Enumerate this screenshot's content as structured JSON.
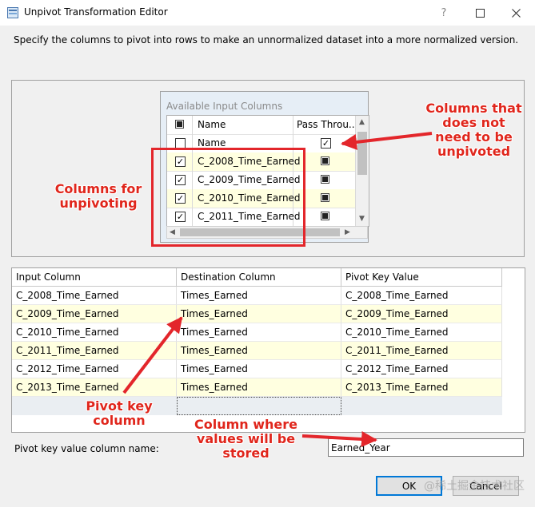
{
  "window": {
    "title": "Unpivot Transformation Editor",
    "help": "?",
    "maximize": "☐",
    "close": "✕"
  },
  "description": "Specify the columns to pivot into rows to make an unnormalized dataset into a more normalized version.",
  "available": {
    "title": "Available Input Columns",
    "headers": {
      "name": "Name",
      "pass": "Pass Throu..."
    },
    "rows": [
      {
        "name": "Name",
        "selected": false,
        "pass": true
      },
      {
        "name": "C_2008_Time_Earned",
        "selected": true,
        "pass": false
      },
      {
        "name": "C_2009_Time_Earned",
        "selected": true,
        "pass": false
      },
      {
        "name": "C_2010_Time_Earned",
        "selected": true,
        "pass": false
      },
      {
        "name": "C_2011_Time_Earned",
        "selected": true,
        "pass": false
      }
    ]
  },
  "mapping": {
    "headers": [
      "Input Column",
      "Destination Column",
      "Pivot Key Value"
    ],
    "rows": [
      [
        "C_2008_Time_Earned",
        "Times_Earned",
        "C_2008_Time_Earned"
      ],
      [
        "C_2009_Time_Earned",
        "Times_Earned",
        "C_2009_Time_Earned"
      ],
      [
        "C_2010_Time_Earned",
        "Times_Earned",
        "C_2010_Time_Earned"
      ],
      [
        "C_2011_Time_Earned",
        "Times_Earned",
        "C_2011_Time_Earned"
      ],
      [
        "C_2012_Time_Earned",
        "Times_Earned",
        "C_2012_Time_Earned"
      ],
      [
        "C_2013_Time_Earned",
        "Times_Earned",
        "C_2013_Time_Earned"
      ]
    ]
  },
  "pivot_key": {
    "label": "Pivot key value column name:",
    "value": "Earned_Year"
  },
  "buttons": {
    "ok": "OK",
    "cancel": "Cancel"
  },
  "annotations": {
    "pass_through": "Columns that does not need to be unpivoted",
    "for_unpivot": "Columns for unpivoting",
    "pivot_key": "Pivot key column",
    "stored": "Column where values will be stored"
  },
  "watermark": "@稀土掘金技术社区",
  "colors": {
    "annotation": "#e0261c",
    "alt_row": "#ffffe0",
    "focus": "#0078d7"
  }
}
